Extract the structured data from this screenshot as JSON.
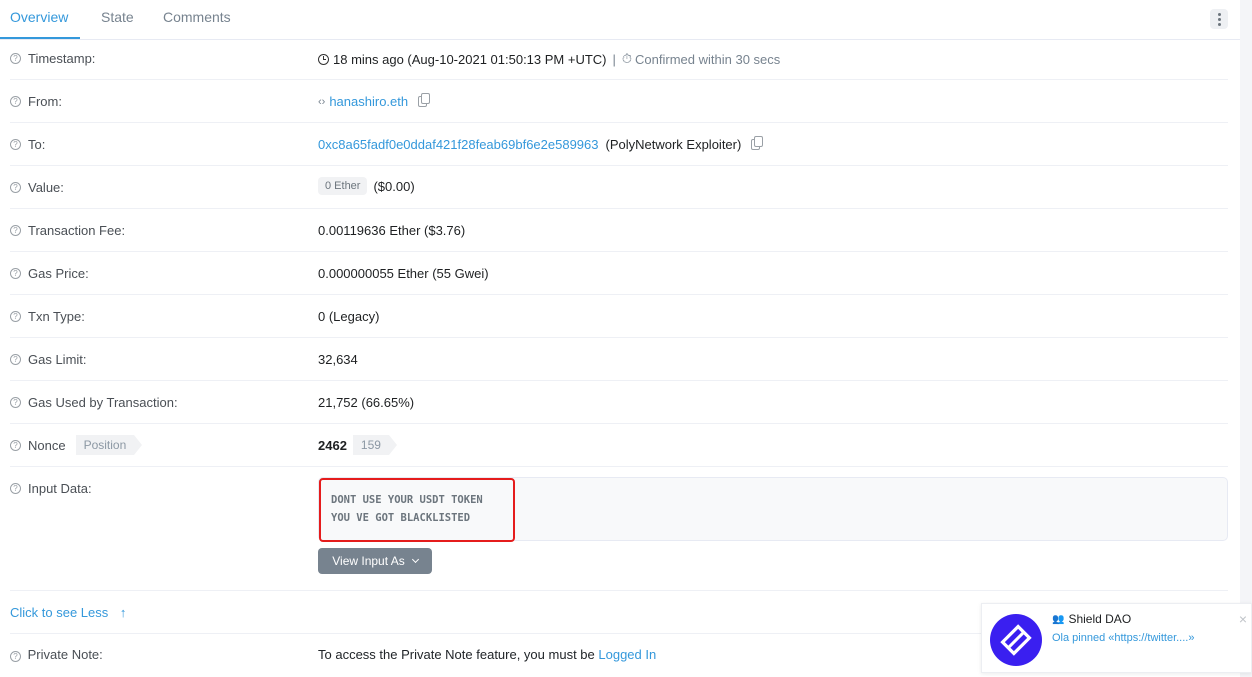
{
  "tabs": [
    {
      "label": "Overview",
      "active": true
    },
    {
      "label": "State",
      "active": false
    },
    {
      "label": "Comments",
      "active": false
    }
  ],
  "more_menu_icon": "vertical-ellipsis-icon",
  "rows": {
    "timestamp": {
      "label": "Timestamp:",
      "value": "18 mins ago (Aug-10-2021 01:50:13 PM +UTC)",
      "separator": "|",
      "confirmed": "Confirmed within 30 secs"
    },
    "from": {
      "label": "From:",
      "value": "hanashiro.eth"
    },
    "to": {
      "label": "To:",
      "address": "0xc8a65fadf0e0ddaf421f28feab69bf6e2e589963",
      "name_tag": "(PolyNetwork Exploiter)"
    },
    "value": {
      "label": "Value:",
      "badge": "0 Ether",
      "usd": "($0.00)"
    },
    "fee": {
      "label": "Transaction Fee:",
      "value": "0.00119636 Ether ($3.76)"
    },
    "gas_price": {
      "label": "Gas Price:",
      "value": "0.000000055 Ether (55 Gwei)"
    },
    "txn_type": {
      "label": "Txn Type:",
      "value": "0 (Legacy)"
    },
    "gas_limit": {
      "label": "Gas Limit:",
      "value": "32,634"
    },
    "gas_used": {
      "label": "Gas Used by Transaction:",
      "value": "21,752 (66.65%)"
    },
    "nonce": {
      "label": "Nonce",
      "position_tag": "Position",
      "value": "2462",
      "position_value": "159"
    },
    "input_data": {
      "label": "Input Data:",
      "text": "DONT USE YOUR USDT TOKEN\nYOU VE GOT BLACKLISTED",
      "view_button": "View Input As"
    },
    "private_note": {
      "label": "Private Note:",
      "text": "To access the Private Note feature, you must be ",
      "link": "Logged In"
    }
  },
  "see_less": "Click to see Less",
  "toast": {
    "title": "Shield DAO",
    "message": "Ola pinned «https://twitter....»",
    "close": "×",
    "logo_color": "#3a1ff0"
  },
  "colors": {
    "accent": "#3498db",
    "highlight_border": "#e51c1c"
  }
}
